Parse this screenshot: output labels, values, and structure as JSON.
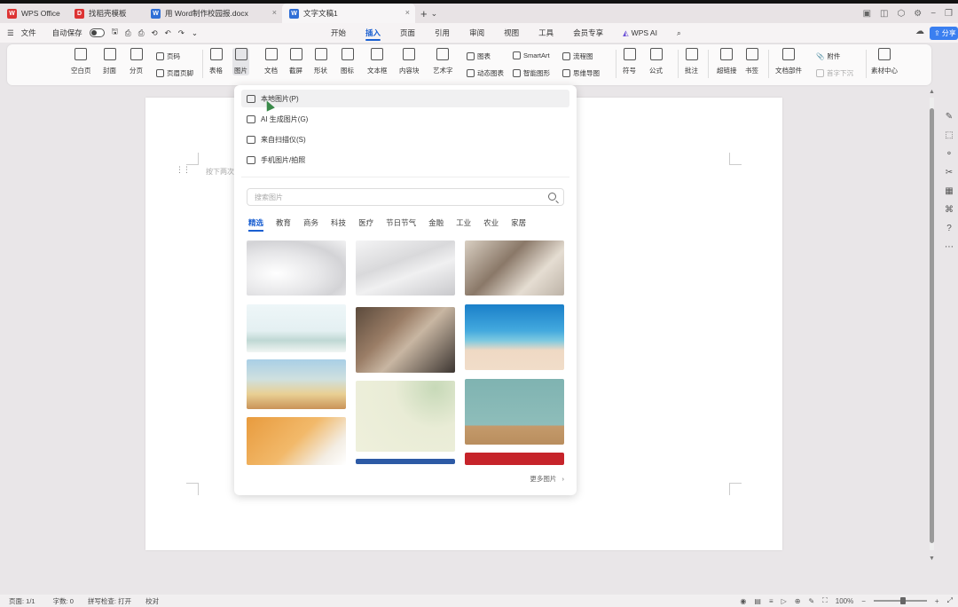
{
  "tabs": [
    {
      "label": "WPS Office",
      "color": "#d33"
    },
    {
      "label": "找稻壳模板",
      "color": "#d33"
    },
    {
      "label": "用 Word制作校园报.docx",
      "color": "#2f6fd6"
    },
    {
      "label": "文字文稿1",
      "color": "#2f6fd6"
    }
  ],
  "window_controls": {
    "add": "+",
    "dropdown": "⌄",
    "minimize": "−",
    "restore": "❐"
  },
  "menubar": {
    "file": "文件",
    "autosave": "自动保存",
    "tabs": [
      "开始",
      "插入",
      "页面",
      "引用",
      "审阅",
      "视图",
      "工具",
      "会员专享",
      "WPS AI"
    ],
    "active_tab": "插入",
    "share": "分享"
  },
  "ribbon": {
    "blank_page": "空白页",
    "cover": "封面",
    "page_break": "分页",
    "header_label": "页码",
    "header_footer": "页眉页脚",
    "table": "表格",
    "picture": "图片",
    "document": "文档",
    "screenshot": "截屏",
    "shape": "形状",
    "icon": "图标",
    "textbox": "文本框",
    "content_block": "内容块",
    "wordart": "艺术字",
    "chart": "图表",
    "dynamic_chart": "动态图表",
    "smartart": "SmartArt",
    "smart_shape": "智能图形",
    "flowchart": "流程图",
    "mindmap": "思维导图",
    "symbol": "符号",
    "formula": "公式",
    "comment": "批注",
    "hyperlink": "超链接",
    "bookmark": "书签",
    "doc_parts": "文档部件",
    "attachment": "附件",
    "first_letter": "首字下沉",
    "material": "素材中心"
  },
  "dropdown": {
    "items": [
      "本地图片(P)",
      "AI 生成图片(G)",
      "来自扫描仪(S)",
      "手机图片/拍照"
    ],
    "search_placeholder": "搜索图片",
    "categories": [
      "精选",
      "教育",
      "商务",
      "科技",
      "医疗",
      "节日节气",
      "金融",
      "工业",
      "农业",
      "家居"
    ],
    "active_category": "精选",
    "more": "更多图片"
  },
  "document": {
    "hint": "按下两次"
  },
  "statusbar": {
    "page": "页面: 1/1",
    "words": "字数: 0",
    "spellcheck": "拼写检查: 打开",
    "proofread": "校对",
    "zoom": "100%",
    "zoom_minus": "−",
    "zoom_plus": "+"
  },
  "colors": {
    "accent": "#1a5fd1",
    "share": "#3a7ff0"
  }
}
